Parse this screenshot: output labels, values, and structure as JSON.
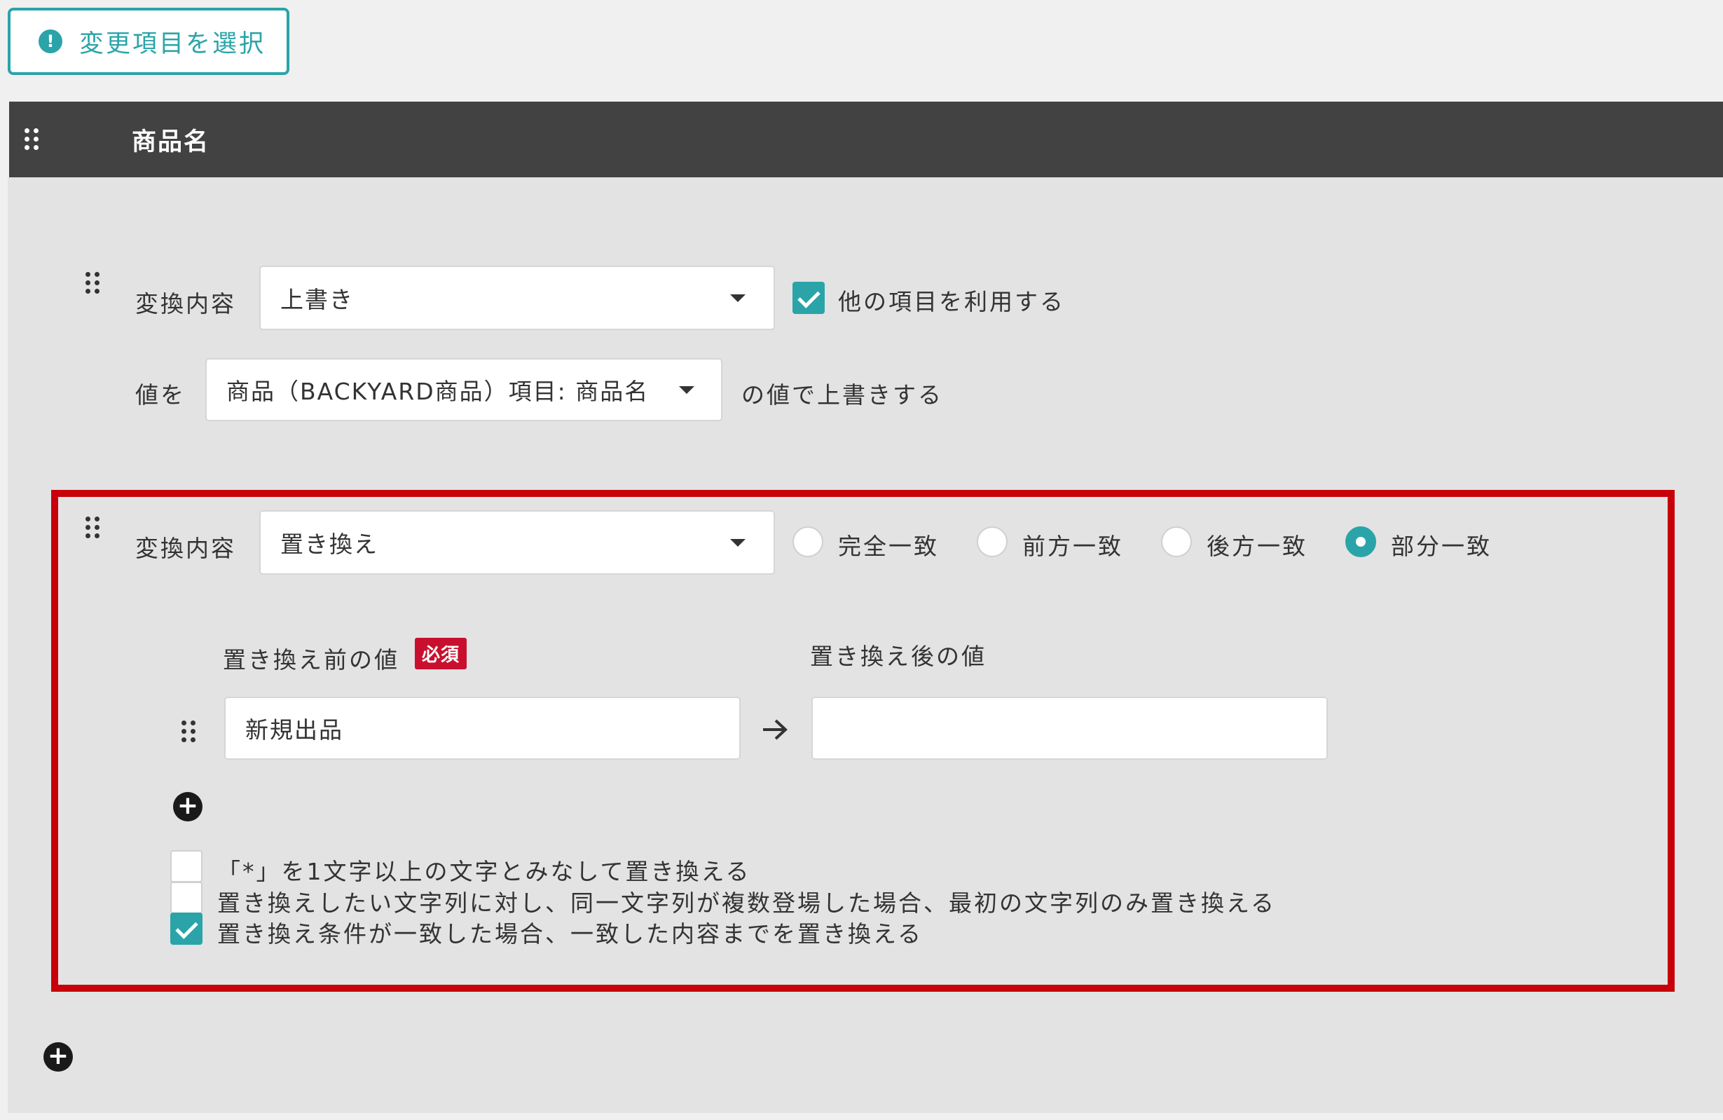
{
  "toolbar": {
    "select_items_label": "変更項目を選択",
    "info_icon": "exclamation-circle-icon",
    "accent_color": "#2aa4a8"
  },
  "header": {
    "title": "商品名",
    "background_color": "#424242"
  },
  "rule1": {
    "conversion_label": "変換内容",
    "conversion_value": "上書き",
    "use_other_item_label": "他の項目を利用する",
    "use_other_item_checked": true,
    "value_prefix": "値を",
    "value_select": "商品（BACKYARD商品）項目: 商品名",
    "value_suffix": "の値で上書きする"
  },
  "rule2": {
    "conversion_label": "変換内容",
    "conversion_value": "置き換え",
    "match_options": [
      {
        "label": "完全一致",
        "checked": false
      },
      {
        "label": "前方一致",
        "checked": false
      },
      {
        "label": "後方一致",
        "checked": false
      },
      {
        "label": "部分一致",
        "checked": true
      }
    ],
    "before_label": "置き換え前の値",
    "required_badge": "必須",
    "after_label": "置き換え後の値",
    "before_value": "新規出品",
    "after_value": "",
    "arrow_icon": "arrow-right-icon",
    "checkbox_options": [
      {
        "label": "「*」を1文字以上の文字とみなして置き換える",
        "checked": false
      },
      {
        "label": "置き換えしたい文字列に対し、同一文字列が複数登場した場合、最初の文字列のみ置き換える",
        "checked": false
      },
      {
        "label": "置き換え条件が一致した場合、一致した内容までを置き換える",
        "checked": true
      }
    ],
    "highlight_color": "#c8000a"
  }
}
